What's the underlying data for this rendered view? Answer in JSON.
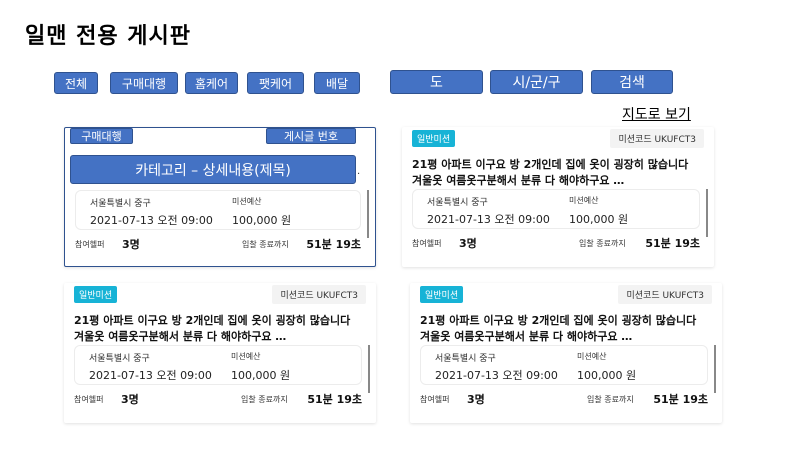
{
  "page_title": "일맨 전용 게시판",
  "filters": {
    "all": "전체",
    "purchase": "구매대행",
    "home_care": "홈케어",
    "pet_care": "팻케어",
    "delivery": "배달"
  },
  "region": {
    "province": "도",
    "city": "시/군/구",
    "search": "검색"
  },
  "map_view": "지도로 보기",
  "overlay": {
    "category_tag": "구매대행",
    "post_number": "게시글 번호",
    "category_detail": "카테고리 – 상세내용(제목)",
    "dot": "."
  },
  "cards": [
    {
      "badge": "",
      "code": "",
      "title": "",
      "location": "서울특별시 중구",
      "date": "2021-07-13 오전 09:00",
      "budget_label": "미션예산",
      "budget": "100,000 원",
      "helpers_label": "참여헬퍼",
      "helpers": "3명",
      "deadline_label": "입찰 종료까지",
      "deadline": "51분 19초"
    },
    {
      "badge": "일반미션",
      "code": "미션코드 UKUFCT3",
      "title": "21평 아파트 이구요 방 2개인데 집에 옷이 굉장히 많습니다 겨울옷 여름옷구분해서 분류 다 해야하구요 …",
      "location": "서울특별시 중구",
      "date": "2021-07-13 오전 09:00",
      "budget_label": "미션예산",
      "budget": "100,000 원",
      "helpers_label": "참여헬퍼",
      "helpers": "3명",
      "deadline_label": "입찰 종료까지",
      "deadline": "51분 19초"
    },
    {
      "badge": "일반미션",
      "code": "미션코드 UKUFCT3",
      "title": "21평 아파트 이구요 방 2개인데 집에 옷이 굉장히 많습니다 겨울옷 여름옷구분해서 분류 다 해야하구요 …",
      "location": "서울특별시 중구",
      "date": "2021-07-13 오전 09:00",
      "budget_label": "미션예산",
      "budget": "100,000 원",
      "helpers_label": "참여헬퍼",
      "helpers": "3명",
      "deadline_label": "입찰 종료까지",
      "deadline": "51분 19초"
    },
    {
      "badge": "일반미션",
      "code": "미션코드 UKUFCT3",
      "title": "21평 아파트 이구요 방 2개인데 집에 옷이 굉장히 많습니다 겨울옷 여름옷구분해서 분류 다 해야하구요 …",
      "location": "서울특별시 중구",
      "date": "2021-07-13 오전 09:00",
      "budget_label": "미션예산",
      "budget": "100,000 원",
      "helpers_label": "참여헬퍼",
      "helpers": "3명",
      "deadline_label": "입찰 종료까지",
      "deadline": "51분 19초"
    }
  ],
  "colors": {
    "accent": "#4472c4",
    "badge": "#17b3d6"
  }
}
